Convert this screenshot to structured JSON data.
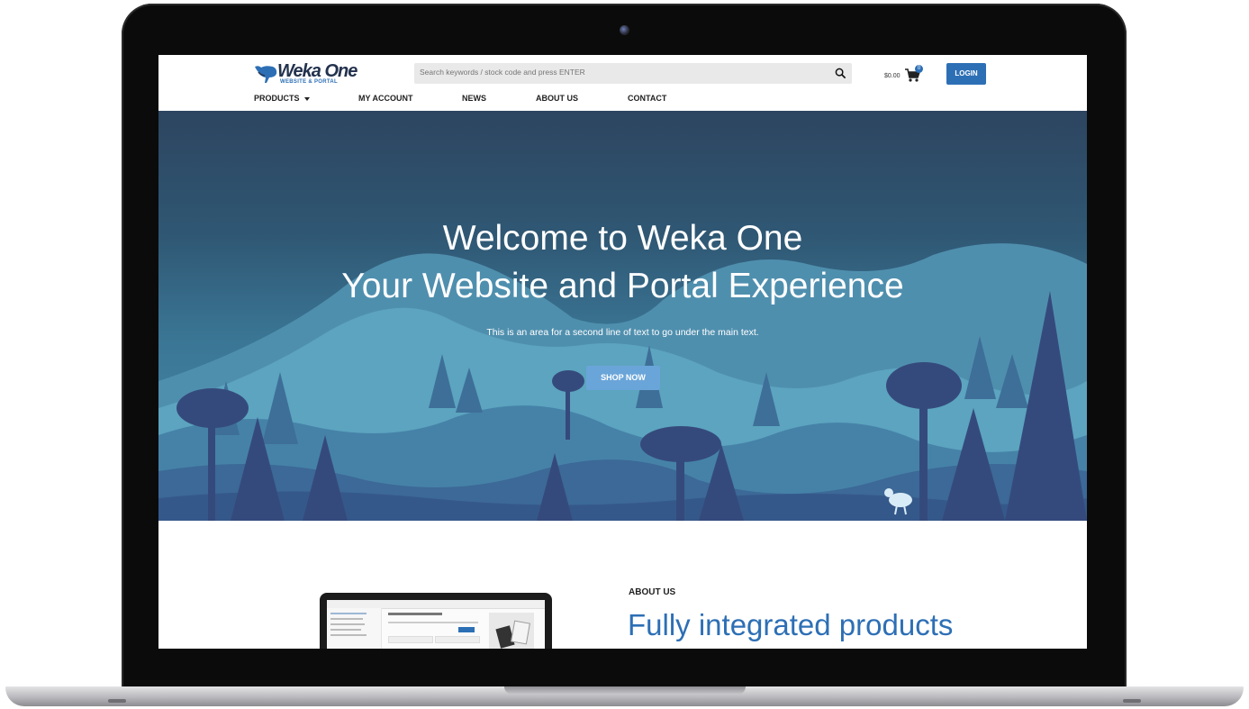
{
  "header": {
    "logo_title": "Weka One",
    "logo_subtitle": "WEBSITE & PORTAL",
    "search_placeholder": "Search keywords / stock code and press ENTER",
    "cart_total": "$0.00",
    "cart_count": "0",
    "login_label": "LOGIN"
  },
  "nav": {
    "items": [
      {
        "label": "PRODUCTS",
        "has_dropdown": true
      },
      {
        "label": "MY ACCOUNT"
      },
      {
        "label": "NEWS"
      },
      {
        "label": "ABOUT US"
      },
      {
        "label": "CONTACT"
      }
    ]
  },
  "hero": {
    "title_line1": "Welcome to Weka One",
    "title_line2": "Your Website and Portal Experience",
    "subtitle": "This is an area for a second line of text to go under the main text.",
    "cta_label": "SHOP NOW"
  },
  "about": {
    "label": "ABOUT US",
    "heading": "Fully integrated products"
  },
  "colors": {
    "brand_blue": "#2d6fb5",
    "logo_navy": "#23324d",
    "hero_top": "#2d4560",
    "hero_bottom": "#4a8db2",
    "cta_blue": "#6aa5d9"
  },
  "icons": {
    "search": "search-icon",
    "cart": "cart-icon",
    "logo": "weka-bird-icon"
  }
}
